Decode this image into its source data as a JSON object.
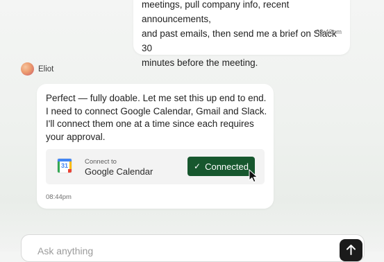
{
  "messages": {
    "user": {
      "lines": [
        "meetings, pull company info, recent announcements,",
        "and past emails, then send me a brief on Slack 30",
        "minutes before the meeting."
      ],
      "time": "08:42pm"
    },
    "agent": {
      "name": "Eliot",
      "lines": [
        "Perfect — fully doable. Let me set this up end to end.",
        "I need to connect Google Calendar, Gmail and Slack.",
        "I'll connect them one at a time since each requires",
        "your approval."
      ],
      "time": "08:44pm",
      "connect_card": {
        "subtitle": "Connect to",
        "title": "Google Calendar",
        "icon": "google-calendar-icon",
        "icon_number": "31",
        "button_label": "Connected",
        "button_color": "#17572e"
      }
    }
  },
  "composer": {
    "placeholder": "Ask anything",
    "send_icon": "arrow-up-icon"
  }
}
